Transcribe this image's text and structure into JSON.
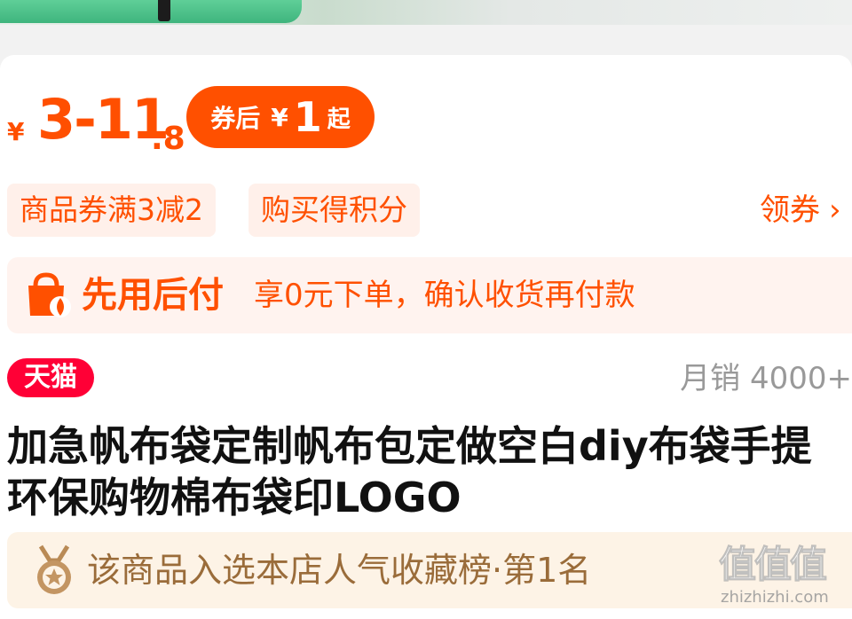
{
  "price": {
    "currency": "¥",
    "range_main": "3-11",
    "range_decimal": ".8",
    "coupon_prefix": "券后",
    "coupon_currency": "¥",
    "coupon_value": "1",
    "coupon_suffix": "起"
  },
  "promo_tags": [
    "商品券满3减2",
    "购买得积分"
  ],
  "get_coupon_label": "领券",
  "pay_later": {
    "title": "先用后付",
    "description": "享0元下单，确认收货再付款"
  },
  "store_badge": "天猫",
  "monthly_sales": "月销 4000+",
  "product_title": "加急帆布袋定制帆布包定做空白diy布袋手提环保购物棉布袋印LOGO",
  "rank_banner": "该商品入选本店人气收藏榜·第1名",
  "watermark": {
    "mark": "值值值",
    "site": "zhizhizhi.com"
  },
  "colors": {
    "accent": "#ff5000",
    "tmall": "#ff0036",
    "rank_text": "#9a6c3a"
  }
}
